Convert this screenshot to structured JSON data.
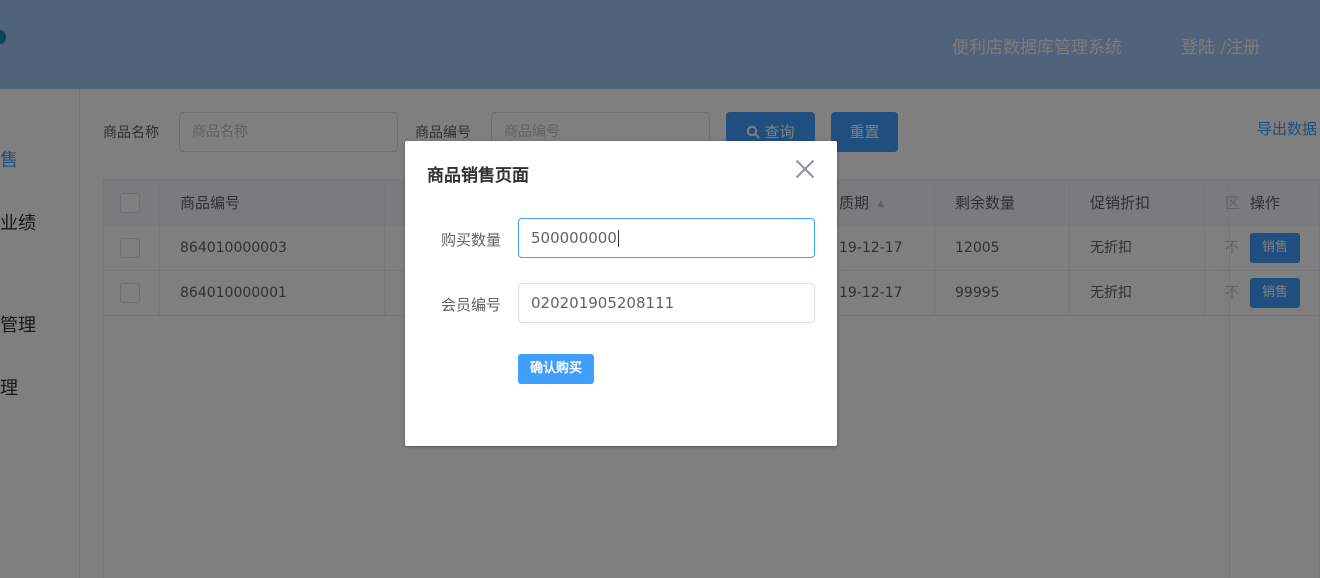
{
  "header": {
    "system_title": "便利店数据库管理系统",
    "login_register": "登陆 /注册"
  },
  "sidebar": {
    "items": [
      {
        "label": "售",
        "active": true
      },
      {
        "label": "业绩",
        "active": false
      },
      {
        "label": "管理",
        "active": false
      },
      {
        "label": "理",
        "active": false
      }
    ]
  },
  "search": {
    "name_label": "商品名称",
    "name_placeholder": "商品名称",
    "code_label": "商品编号",
    "code_placeholder": "商品编号",
    "query_button": "查询",
    "reset_button": "重置",
    "export_link": "导出数据"
  },
  "table": {
    "columns": [
      "商品编号",
      "质期",
      "剩余数量",
      "促销折扣",
      "区",
      "操作"
    ],
    "rows": [
      {
        "code": "864010000003",
        "date": "19-12-17",
        "remaining": "12005",
        "discount": "无折扣",
        "extra": "不",
        "action": "销售"
      },
      {
        "code": "864010000001",
        "date": "19-12-17",
        "remaining": "99995",
        "discount": "无折扣",
        "extra": "不",
        "action": "销售"
      }
    ]
  },
  "dialog": {
    "title": "商品销售页面",
    "quantity_label": "购买数量",
    "quantity_value": "500000000",
    "member_label": "会员编号",
    "member_value": "020201905208111",
    "confirm_button": "确认购买"
  },
  "colors": {
    "primary": "#409eff",
    "header_bg": "#a3c7f7",
    "overlay": "rgba(0,0,0,0.5)"
  }
}
